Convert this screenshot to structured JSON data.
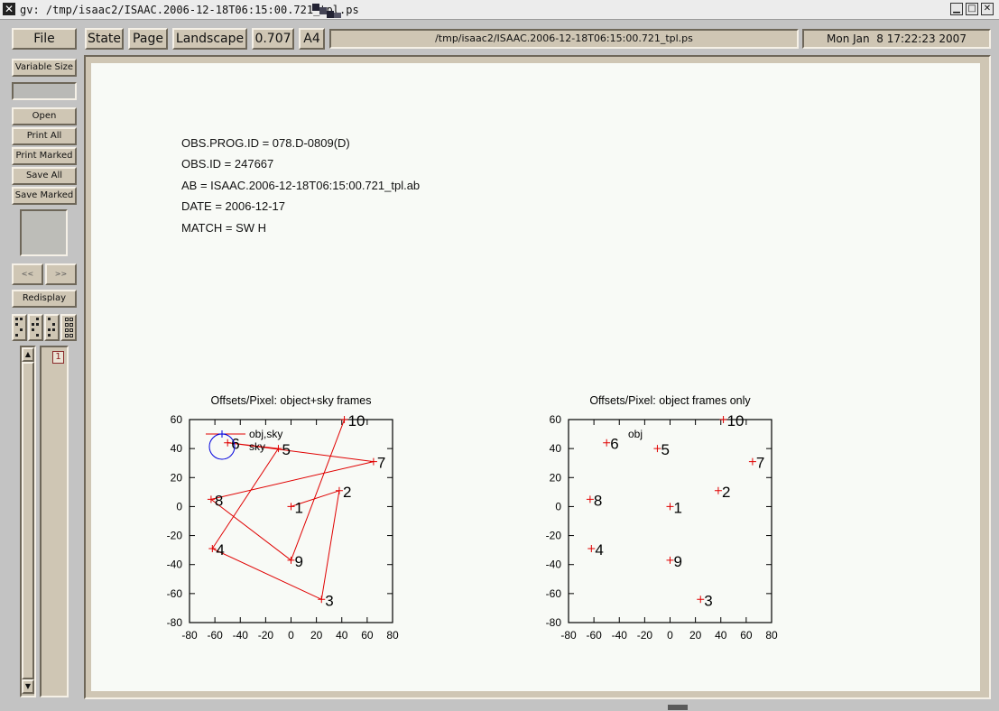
{
  "window": {
    "title": "gv: /tmp/isaac2/ISAAC.2006-12-18T06:15:00.721_tpl.ps",
    "minimize_glyph": "▁",
    "maximize_glyph": "□",
    "close_glyph": "✕"
  },
  "toolbar": {
    "file": "File",
    "state": "State",
    "page": "Page",
    "orientation": "Landscape",
    "scale": "0.707",
    "media": "A4",
    "filename": "/tmp/isaac2/ISAAC.2006-12-18T06:15:00.721_tpl.ps",
    "date": "Mon Jan  8 17:22:23 2007"
  },
  "sidebar": {
    "variable_size": "Variable Size",
    "open": "Open",
    "print_all": "Print All",
    "print_marked": "Print Marked",
    "save_all": "Save All",
    "save_marked": "Save Marked",
    "prev": "<<",
    "next": ">>",
    "redisplay": "Redisplay",
    "page_number": "1"
  },
  "document": {
    "lines": [
      "OBS.PROG.ID = 078.D-0809(D)",
      "OBS.ID = 247667",
      "AB = ISAAC.2006-12-18T06:15:00.721_tpl.ab",
      "DATE = 2006-12-17",
      "MATCH = SW H"
    ]
  },
  "chart_data": [
    {
      "type": "line",
      "title": "Offsets/Pixel: object+sky frames",
      "xlim": [
        -80,
        80
      ],
      "ylim": [
        -80,
        60
      ],
      "xticks": [
        -80,
        -60,
        -40,
        -20,
        0,
        20,
        40,
        60,
        80
      ],
      "yticks": [
        60,
        40,
        20,
        0,
        -20,
        -40,
        -60,
        -80
      ],
      "legend": [
        "obj,sky",
        "sky"
      ],
      "legend_position": "top-left",
      "line_color": "#e00000",
      "sky_marker_color": "#0000dd",
      "points": [
        {
          "label": "1",
          "x": 0,
          "y": 0
        },
        {
          "label": "2",
          "x": 38,
          "y": 11
        },
        {
          "label": "3",
          "x": 24,
          "y": -64
        },
        {
          "label": "4",
          "x": -62,
          "y": -29
        },
        {
          "label": "5",
          "x": -10,
          "y": 40
        },
        {
          "label": "6",
          "x": -50,
          "y": 44
        },
        {
          "label": "7",
          "x": 65,
          "y": 31
        },
        {
          "label": "8",
          "x": -63,
          "y": 5
        },
        {
          "label": "9",
          "x": 0,
          "y": -37
        },
        {
          "label": "10",
          "x": 42,
          "y": 60
        }
      ],
      "path_order": [
        "1",
        "2",
        "3",
        "4",
        "5",
        "6",
        "7",
        "8",
        "9",
        "10"
      ]
    },
    {
      "type": "scatter",
      "title": "Offsets/Pixel: object frames only",
      "xlim": [
        -80,
        80
      ],
      "ylim": [
        -80,
        60
      ],
      "xticks": [
        -80,
        -60,
        -40,
        -20,
        0,
        20,
        40,
        60,
        80
      ],
      "yticks": [
        60,
        40,
        20,
        0,
        -20,
        -40,
        -60,
        -80
      ],
      "legend": [
        "obj"
      ],
      "legend_position": "top-left",
      "marker_color": "#e00000",
      "points": [
        {
          "label": "1",
          "x": 0,
          "y": 0
        },
        {
          "label": "2",
          "x": 38,
          "y": 11
        },
        {
          "label": "3",
          "x": 24,
          "y": -64
        },
        {
          "label": "4",
          "x": -62,
          "y": -29
        },
        {
          "label": "5",
          "x": -10,
          "y": 40
        },
        {
          "label": "6",
          "x": -50,
          "y": 44
        },
        {
          "label": "7",
          "x": 65,
          "y": 31
        },
        {
          "label": "8",
          "x": -63,
          "y": 5
        },
        {
          "label": "9",
          "x": 0,
          "y": -37
        },
        {
          "label": "10",
          "x": 42,
          "y": 60
        }
      ]
    }
  ]
}
